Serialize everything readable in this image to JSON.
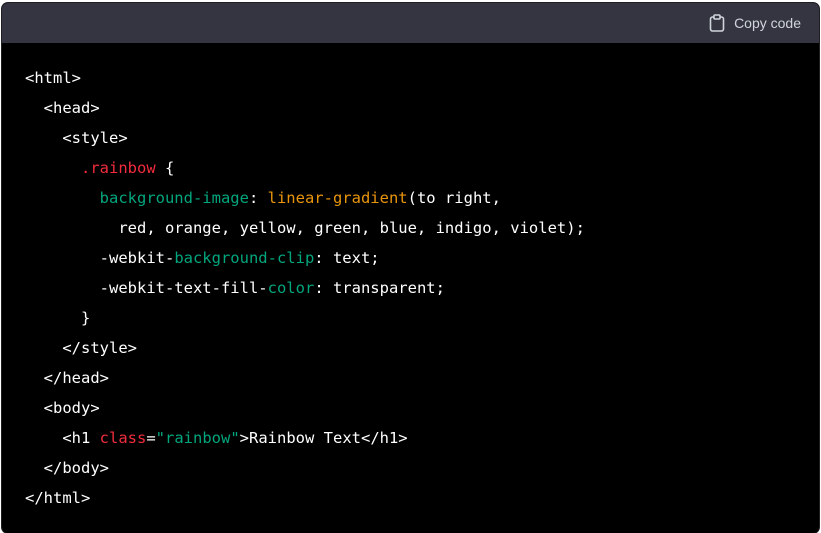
{
  "header": {
    "copy_label": "Copy code",
    "copy_icon": "clipboard-icon"
  },
  "code_lines": [
    [
      {
        "t": "<html>",
        "c": "default"
      }
    ],
    [
      {
        "t": "  <head>",
        "c": "default"
      }
    ],
    [
      {
        "t": "    <style>",
        "c": "default"
      }
    ],
    [
      {
        "t": "      ",
        "c": "default"
      },
      {
        "t": ".rainbow",
        "c": "selector"
      },
      {
        "t": " {",
        "c": "default"
      }
    ],
    [
      {
        "t": "        ",
        "c": "default"
      },
      {
        "t": "background-image",
        "c": "prop"
      },
      {
        "t": ": ",
        "c": "default"
      },
      {
        "t": "linear-gradient",
        "c": "fn-orange"
      },
      {
        "t": "(to right,",
        "c": "default"
      }
    ],
    [
      {
        "t": "          red, orange, yellow, green, blue, indigo, violet);",
        "c": "default"
      }
    ],
    [
      {
        "t": "        -webkit-",
        "c": "default"
      },
      {
        "t": "background-clip",
        "c": "prop"
      },
      {
        "t": ": text;",
        "c": "default"
      }
    ],
    [
      {
        "t": "        -webkit-text-fill-",
        "c": "default"
      },
      {
        "t": "color",
        "c": "prop"
      },
      {
        "t": ": transparent;",
        "c": "default"
      }
    ],
    [
      {
        "t": "      }",
        "c": "default"
      }
    ],
    [
      {
        "t": "    </style>",
        "c": "default"
      }
    ],
    [
      {
        "t": "  </head>",
        "c": "default"
      }
    ],
    [
      {
        "t": "  <body>",
        "c": "default"
      }
    ],
    [
      {
        "t": "    <h1 ",
        "c": "default"
      },
      {
        "t": "class",
        "c": "attr"
      },
      {
        "t": "=",
        "c": "default"
      },
      {
        "t": "\"rainbow\"",
        "c": "string"
      },
      {
        "t": ">Rainbow Text</h1>",
        "c": "default"
      }
    ],
    [
      {
        "t": "  </body>",
        "c": "default"
      }
    ],
    [
      {
        "t": "</html>",
        "c": "default"
      }
    ]
  ],
  "colors": {
    "background": "#000000",
    "header_bg": "#343541",
    "text": "#ffffff",
    "selector": "#f22c3d",
    "property": "#00a67d",
    "function": "#e9950c",
    "string": "#00a67d"
  }
}
